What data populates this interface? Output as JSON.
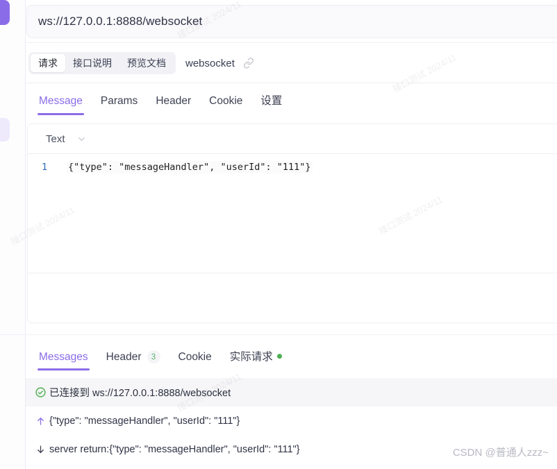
{
  "url_bar": {
    "value": "ws://127.0.0.1:8888/websocket",
    "placeholder": "ws://"
  },
  "segmented": {
    "items": [
      {
        "label": "请求",
        "active": true
      },
      {
        "label": "接口说明",
        "active": false
      },
      {
        "label": "预览文档",
        "active": false
      }
    ],
    "side_label": "websocket",
    "link_icon": "link-icon"
  },
  "request_tabs": [
    {
      "label": "Message",
      "active": true
    },
    {
      "label": "Params",
      "active": false
    },
    {
      "label": "Header",
      "active": false
    },
    {
      "label": "Cookie",
      "active": false
    },
    {
      "label": "设置",
      "active": false
    }
  ],
  "editor": {
    "format_label": "Text",
    "chevron_icon": "chevron-down-icon",
    "line_number": "1",
    "content": "{\"type\": \"messageHandler\", \"userId\": \"111\"}"
  },
  "response_tabs": [
    {
      "label": "Messages",
      "active": true,
      "badge": "",
      "dot": false
    },
    {
      "label": "Header",
      "active": false,
      "badge": "3",
      "dot": false
    },
    {
      "label": "Cookie",
      "active": false,
      "badge": "",
      "dot": false
    },
    {
      "label": "实际请求",
      "active": false,
      "badge": "",
      "dot": true
    }
  ],
  "messages": [
    {
      "icon": "check-circle-icon",
      "text": "已连接到 ws://127.0.0.1:8888/websocket",
      "highlight": true
    },
    {
      "icon": "arrow-up-icon",
      "text": "{\"type\": \"messageHandler\", \"userId\": \"111\"}",
      "highlight": false
    },
    {
      "icon": "arrow-down-icon",
      "text": "server return:{\"type\": \"messageHandler\", \"userId\": \"111\"}",
      "highlight": false
    }
  ],
  "watermarks": {
    "tiled": "接口测试 2024/11",
    "csdn": "CSDN @普通人zzz~"
  },
  "colors": {
    "accent": "#8b6ce8",
    "success": "#4caf50",
    "badge_text": "#52b36b",
    "text": "#303345"
  }
}
